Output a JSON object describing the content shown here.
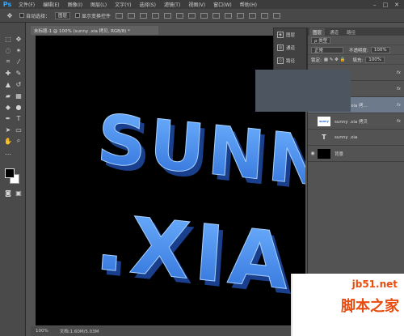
{
  "app": {
    "logo": "Ps",
    "menu": [
      "文件(F)",
      "编辑(E)",
      "图像(I)",
      "图层(L)",
      "文字(Y)",
      "选择(S)",
      "滤镜(T)",
      "视图(V)",
      "窗口(W)",
      "帮助(H)"
    ],
    "window_controls": [
      "–",
      "□",
      "✕"
    ]
  },
  "options_bar": {
    "auto_select_label": "自动选择：",
    "auto_select_value": "图层",
    "show_transform_label": "显示变换控件"
  },
  "document": {
    "tab_title": "未标题-1 @ 100% (sunny .xia 拷贝, RGB/8) *",
    "canvas_text_line1": "SUNN",
    "canvas_text_line2": ".XIA",
    "zoom": "100%",
    "doc_info": "文档:1.60M/5.03M"
  },
  "mini_panel": {
    "items": [
      {
        "label": "图层",
        "icon": "layers-icon"
      },
      {
        "label": "通道",
        "icon": "channels-icon"
      },
      {
        "label": "路径",
        "icon": "paths-icon"
      }
    ]
  },
  "layers_panel": {
    "tabs": [
      "图层",
      "通道",
      "路径"
    ],
    "kind_label": "ρ 类型",
    "blend_mode": "正常",
    "opacity_label": "不透明度:",
    "opacity_value": "100%",
    "lock_label": "锁定:",
    "fill_label": "填充:",
    "fill_value": "100%",
    "layers": [
      {
        "name": "sunny .xia 拷...",
        "thumb": "sunny",
        "fx": "fx",
        "selected": true
      },
      {
        "name": "sunny .xia 拷贝",
        "thumb": "sunny",
        "fx": "fx",
        "selected": false
      },
      {
        "name": "sunny .xia",
        "thumb": "T",
        "fx": "",
        "selected": false
      },
      {
        "name": "背景",
        "thumb": "",
        "fx": "",
        "selected": false
      }
    ],
    "above_layers": [
      {
        "fx": "fx"
      },
      {
        "fx": "fx"
      }
    ]
  },
  "watermark": {
    "site": "jb51.net",
    "brand": "脚本之家"
  },
  "colors": {
    "text_blue": "#3f8ef0",
    "selection": "#6d7a8c"
  }
}
